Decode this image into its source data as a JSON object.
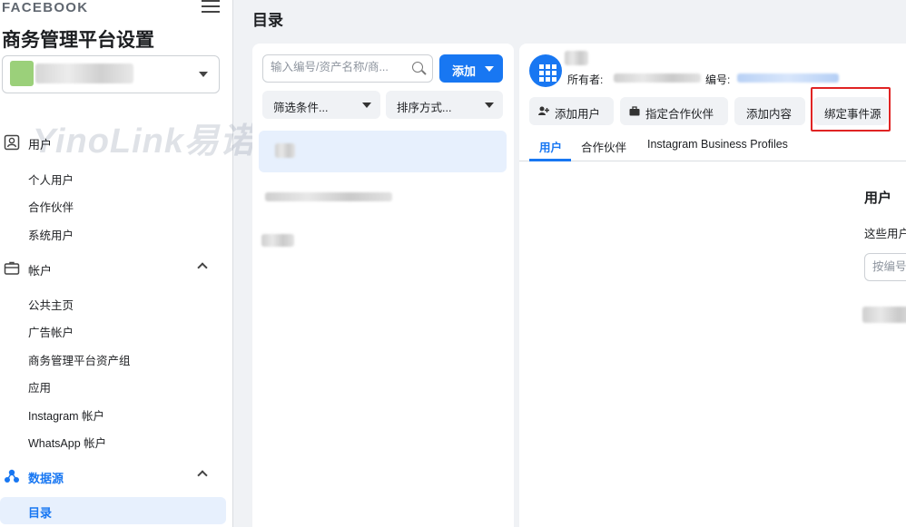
{
  "sidebar": {
    "brand": "FACEBOOK",
    "title": "商务管理平台设置",
    "watermark": "YinoLink易诺",
    "sections": {
      "users": {
        "label": "用户",
        "items": [
          "个人用户",
          "合作伙伴",
          "系统用户"
        ]
      },
      "accounts": {
        "label": "帐户",
        "items": [
          "公共主页",
          "广告帐户",
          "商务管理平台资产组",
          "应用",
          "Instagram 帐户",
          "WhatsApp 帐户"
        ]
      },
      "data_sources": {
        "label": "数据源",
        "active_item": "目录"
      }
    }
  },
  "main": {
    "title": "目录",
    "list": {
      "search_placeholder": "输入编号/资产名称/商...",
      "add_label": "添加",
      "filter_label": "筛选条件...",
      "sort_label": "排序方式..."
    },
    "detail": {
      "owner_label": "所有者:",
      "id_label": "编号:",
      "actions": [
        "添加用户",
        "指定合作伙伴",
        "添加内容",
        "绑定事件源"
      ],
      "tabs": [
        "用户",
        "合作伙伴",
        "Instagram Business Profiles"
      ],
      "users_title": "用户",
      "users_desc": "这些用户",
      "users_search_placeholder": "按编号"
    }
  },
  "colors": {
    "accent": "#1877f2",
    "highlight": "#e02424"
  }
}
